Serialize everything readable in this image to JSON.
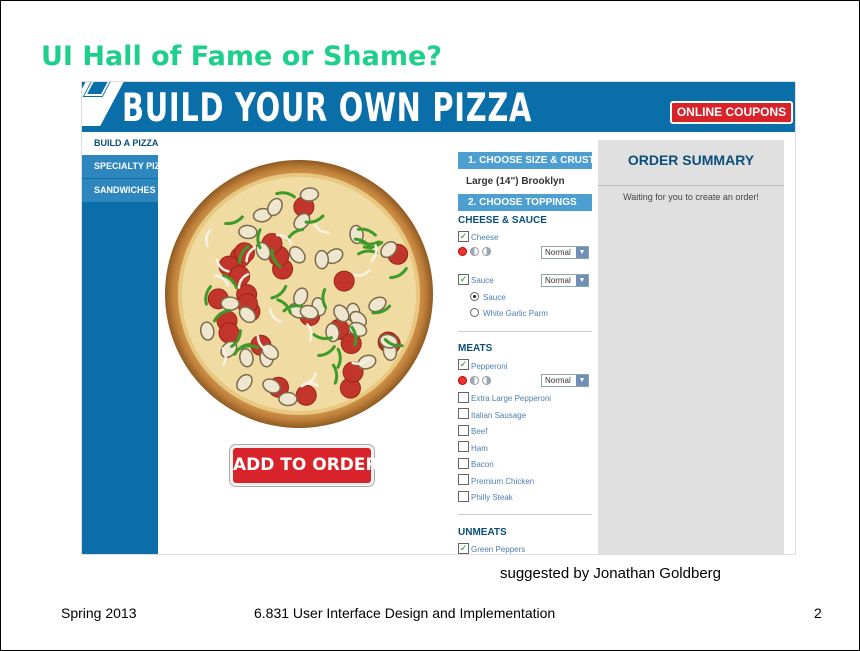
{
  "slide": {
    "title": "UI Hall of Fame or Shame?",
    "credit": "suggested by Jonathan Goldberg",
    "footer_left": "Spring 2013",
    "footer_center": "6.831 User Interface Design and Implementation",
    "page_number": "2"
  },
  "site": {
    "banner_title": "BUILD YOUR OWN PIZZA",
    "coupons_button": "ONLINE COUPONS",
    "sidebar": [
      {
        "label": "BUILD A PIZZA",
        "active": true
      },
      {
        "label": "SPECIALTY PIZZAS",
        "active": false
      },
      {
        "label": "SANDWICHES",
        "active": false
      }
    ],
    "add_to_order": "ADD TO ORDER",
    "step1": {
      "label": "1. CHOOSE SIZE & CRUST",
      "value": "Large (14\") Brooklyn"
    },
    "step2": {
      "label": "2. CHOOSE TOPPINGS"
    },
    "cheese_sauce": {
      "heading": "CHEESE & SAUCE",
      "cheese": {
        "label": "Cheese",
        "checked": true,
        "amount": "Normal"
      },
      "sauce": {
        "label": "Sauce",
        "checked": true,
        "amount": "Normal"
      },
      "sauce_options": [
        {
          "label": "Sauce",
          "selected": true
        },
        {
          "label": "White Garlic Parm",
          "selected": false
        }
      ]
    },
    "meats": {
      "heading": "MEATS",
      "pepperoni": {
        "label": "Pepperoni",
        "checked": true,
        "amount": "Normal"
      },
      "others": [
        "Extra Large Pepperoni",
        "Italian Sausage",
        "Beef",
        "Ham",
        "Bacon",
        "Premium Chicken",
        "Philly Steak"
      ]
    },
    "unmeats": {
      "heading": "UNMEATS",
      "first": {
        "label": "Green Peppers",
        "checked": true
      }
    },
    "order_summary": {
      "title": "ORDER SUMMARY",
      "text": "Waiting for you to create an order!"
    }
  },
  "colors": {
    "title_green": "#1dcf8a",
    "brand_blue": "#0a6ea8",
    "accent_red": "#d8232a",
    "summary_bg": "#e0e0e0"
  }
}
